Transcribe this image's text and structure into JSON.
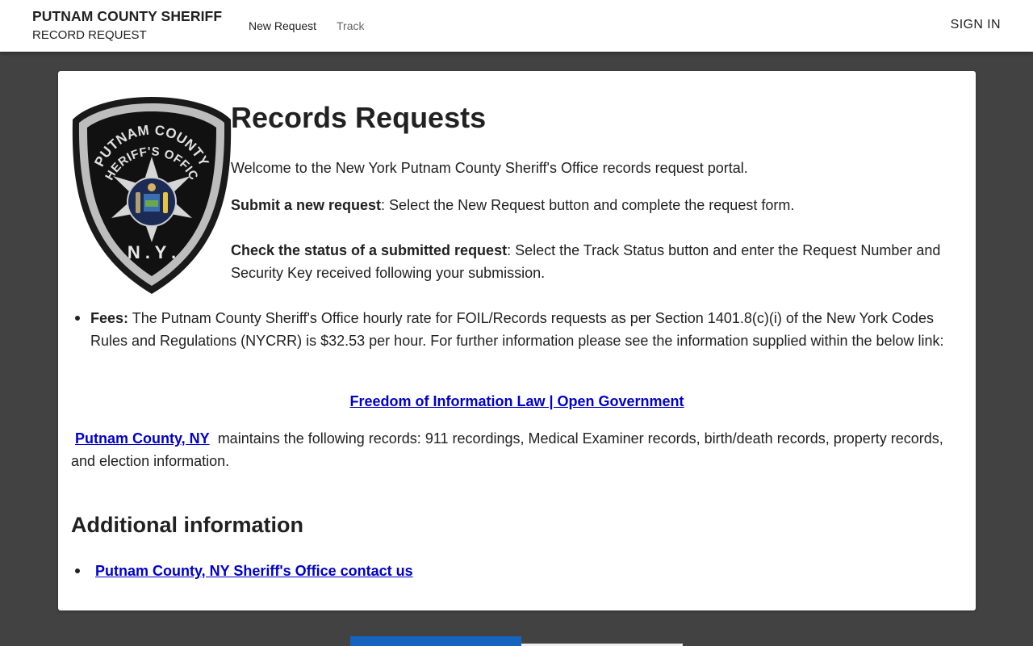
{
  "header": {
    "title": "PUTNAM COUNTY SHERIFF",
    "subtitle": "RECORD REQUEST",
    "nav": [
      {
        "label": "New Request"
      },
      {
        "label": "Track"
      }
    ],
    "sign_in": "SIGN IN"
  },
  "badge": {
    "line1": "PUTNAM COUNTY",
    "line2": "SHERIFF'S OFFICE",
    "state": "N . Y ."
  },
  "main": {
    "title": "Records Requests",
    "welcome": "Welcome to the New York Putnam County Sheriff's Office records request portal.",
    "submit_label": "Submit a new request",
    "submit_text": ": Select the New Request button and complete the request form.",
    "check_label": "Check the status of a submitted request",
    "check_text": ": Select the Track Status button and enter the Request Number and Security Key received following your submission.",
    "fees_label": "Fees:",
    "fees_text": " The Putnam County Sheriff's Office hourly rate for FOIL/Records requests as per Section 1401.8(c)(i) of the New York Codes Rules and Regulations (NYCRR) is $32.53 per hour.  For further information please see the information supplied within the below link:",
    "foil_link": "Freedom of Information Law | Open Government",
    "county_link": "Putnam County, NY",
    "county_text": "  maintains the following records: 911 recordings, Medical Examiner records, birth/death records, property records, and election information."
  },
  "additional": {
    "title": "Additional information",
    "contact_link": "Putnam County, NY Sheriff's Office contact us"
  },
  "colors": {
    "page_bg": "#424242",
    "link": "#0000cc",
    "accent": "#1565c0"
  }
}
